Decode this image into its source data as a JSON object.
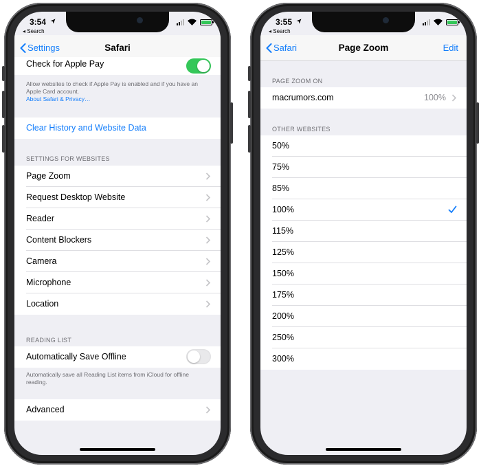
{
  "left_phone": {
    "status": {
      "time": "3:54",
      "back_app": "◂ Search",
      "battery_color": "#34c759"
    },
    "nav": {
      "back_label": "Settings",
      "title": "Safari"
    },
    "apple_pay": {
      "label": "Check for Apple Pay",
      "toggle_on": true,
      "footer": "Allow websites to check if Apple Pay is enabled and if you have an Apple Card account.",
      "footer_link": "About Safari & Privacy…"
    },
    "clear_history_label": "Clear History and Website Data",
    "settings_for_websites": {
      "header": "SETTINGS FOR WEBSITES",
      "items": [
        "Page Zoom",
        "Request Desktop Website",
        "Reader",
        "Content Blockers",
        "Camera",
        "Microphone",
        "Location"
      ]
    },
    "reading_list": {
      "header": "READING LIST",
      "label": "Automatically Save Offline",
      "toggle_on": false,
      "footer": "Automatically save all Reading List items from iCloud for offline reading."
    },
    "advanced_label": "Advanced"
  },
  "right_phone": {
    "status": {
      "time": "3:55",
      "back_app": "◂ Search",
      "battery_color": "#34c759"
    },
    "nav": {
      "back_label": "Safari",
      "title": "Page Zoom",
      "edit_label": "Edit"
    },
    "page_zoom_on": {
      "header": "PAGE ZOOM ON",
      "site": "macrumors.com",
      "value": "100%"
    },
    "other_websites": {
      "header": "OTHER WEBSITES",
      "options": [
        "50%",
        "75%",
        "85%",
        "100%",
        "115%",
        "125%",
        "150%",
        "175%",
        "200%",
        "250%",
        "300%"
      ],
      "selected": "100%"
    }
  },
  "colors": {
    "accent": "#147efb",
    "toggle_on": "#34c759",
    "background": "#efeff4"
  }
}
